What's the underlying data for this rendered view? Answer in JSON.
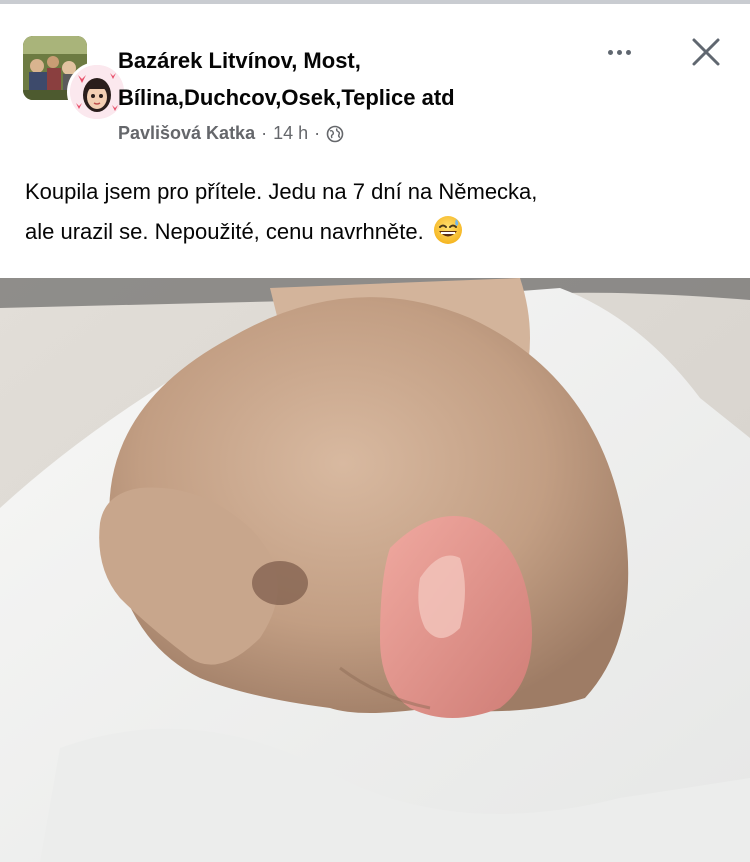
{
  "post": {
    "group_name_line1": "Bazárek Litvínov, Most,",
    "group_name_line2": "Bílina,Duchcov,Osek,Teplice atd",
    "author": "Pavlišová Katka",
    "separator": "·",
    "time": "14 h",
    "text_line1": "Koupila jsem pro přítele. Jedu na 7 dní na Německa,",
    "text_line2": "ale urazil se. Nepoužité, cenu navrhněte.",
    "emoji": "grinning-sweat-emoji",
    "privacy_icon": "globe-icon"
  },
  "icons": {
    "more": "more-options-icon",
    "close": "close-icon"
  },
  "colors": {
    "text_primary": "#050505",
    "text_secondary": "#65676b",
    "icon_gray": "#606770"
  }
}
